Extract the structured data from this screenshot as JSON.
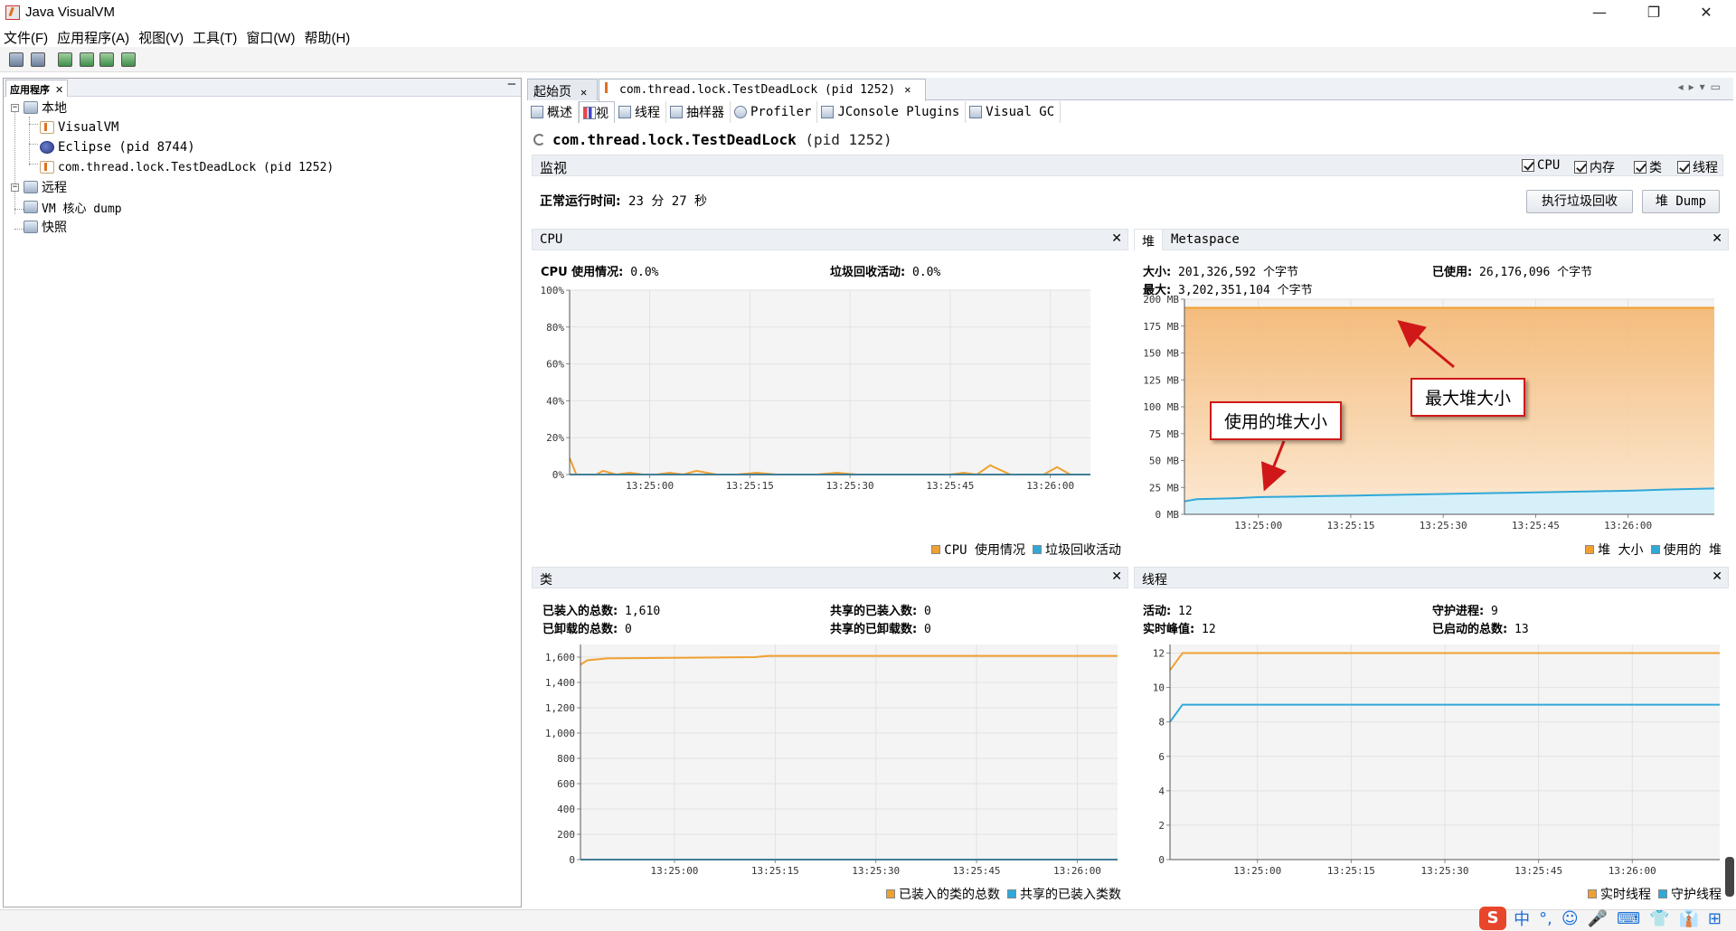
{
  "window": {
    "title": "Java VisualVM",
    "controls": {
      "minimize": "—",
      "restore": "❐",
      "close": "✕"
    }
  },
  "menubar": [
    "文件(F)",
    "应用程序(A)",
    "视图(V)",
    "工具(T)",
    "窗口(W)",
    "帮助(H)"
  ],
  "left_pane": {
    "tab_label": "应用程序",
    "tree": {
      "local": "本地",
      "visualvm": "VisualVM",
      "eclipse": "Eclipse (pid 8744)",
      "deadlock": "com.thread.lock.TestDeadLock (pid 1252)",
      "remote": "远程",
      "core_dump": "VM 核心 dump",
      "snapshots": "快照"
    }
  },
  "doc_tabs": {
    "start_page": "起始页",
    "process": "com.thread.lock.TestDeadLock (pid 1252)"
  },
  "sub_tabs": [
    "概述",
    "监视",
    "线程",
    "抽样器",
    "Profiler",
    "JConsole Plugins",
    "Visual GC"
  ],
  "heading": {
    "name": "com.thread.lock.TestDeadLock",
    "pid": "(pid 1252)"
  },
  "monitor_bar": {
    "label": "监视",
    "checkboxes": [
      "CPU",
      "内存",
      "类",
      "线程"
    ]
  },
  "uptime": {
    "label": "正常运行时间:",
    "value": "23 分 27 秒"
  },
  "buttons": {
    "gc": "执行垃圾回收",
    "heap_dump": "堆 Dump"
  },
  "cpu_panel": {
    "title": "CPU",
    "usage_label": "CPU 使用情况:",
    "usage_value": "0.0%",
    "gc_label": "垃圾回收活动:",
    "gc_value": "0.0%",
    "legend": [
      "CPU 使用情况",
      "垃圾回收活动"
    ]
  },
  "heap_panel": {
    "tab_heap": "堆",
    "tab_meta": "Metaspace",
    "size_label": "大小:",
    "size_value": "201,326,592 个字节",
    "max_label": "最大:",
    "max_value": "3,202,351,104 个字节",
    "used_label": "已使用:",
    "used_value": "26,176,096 个字节",
    "legend": [
      "堆 大小",
      "使用的 堆"
    ]
  },
  "classes_panel": {
    "title": "类",
    "loaded_label": "已装入的总数:",
    "loaded_value": "1,610",
    "unloaded_label": "已卸载的总数:",
    "unloaded_value": "0",
    "shared_loaded_label": "共享的已装入数:",
    "shared_loaded_value": "0",
    "shared_unloaded_label": "共享的已卸载数:",
    "shared_unloaded_value": "0",
    "legend": [
      "已装入的类的总数",
      "共享的已装入类数"
    ]
  },
  "threads_panel": {
    "title": "线程",
    "live_label": "活动:",
    "live_value": "12",
    "peak_label": "实时峰值:",
    "peak_value": "12",
    "daemon_label": "守护进程:",
    "daemon_value": "9",
    "started_label": "已启动的总数:",
    "started_value": "13",
    "legend": [
      "实时线程",
      "守护线程"
    ]
  },
  "callouts": {
    "max_heap": "最大堆大小",
    "used_heap": "使用的堆大小"
  },
  "ime": {
    "logo": "S",
    "items": [
      "中",
      "°,",
      "☺",
      "🎤",
      "⌨",
      "👕",
      "👔",
      "⊞"
    ]
  },
  "colors": {
    "orange": "#f0a030",
    "blue": "#30a8d8",
    "heap_fill": "#f6c58c",
    "used_fill": "#d6f0fa",
    "callout_border": "#d01818"
  },
  "chart_data": [
    {
      "type": "line",
      "name": "cpu",
      "ylim": [
        0,
        100
      ],
      "yticks": [
        "100%",
        "80%",
        "60%",
        "40%",
        "20%",
        "0%"
      ],
      "xticks": [
        "13:25:00",
        "13:25:15",
        "13:25:30",
        "13:25:45",
        "13:26:00"
      ],
      "series": [
        {
          "name": "CPU 使用情况",
          "color": "#f0a030",
          "x": [
            "13:24:48",
            "13:24:49",
            "13:24:52",
            "13:24:53",
            "13:24:55",
            "13:24:57",
            "13:24:59",
            "13:25:01",
            "13:25:03",
            "13:25:05",
            "13:25:07",
            "13:25:10",
            "13:25:13",
            "13:25:16",
            "13:25:19",
            "13:25:22",
            "13:25:25",
            "13:25:28",
            "13:25:31",
            "13:25:34",
            "13:25:37",
            "13:25:40",
            "13:25:43",
            "13:25:45",
            "13:25:47",
            "13:25:49",
            "13:25:51",
            "13:25:54",
            "13:25:57",
            "13:25:59",
            "13:26:01",
            "13:26:03",
            "13:26:06"
          ],
          "values": [
            9,
            0,
            0,
            2,
            0,
            1,
            0,
            0,
            1,
            0,
            2,
            0,
            0,
            1,
            0,
            0,
            0,
            1,
            0,
            0,
            0,
            0,
            0,
            0,
            1,
            0,
            5,
            0,
            0,
            0,
            4,
            0,
            0
          ]
        },
        {
          "name": "垃圾回收活动",
          "color": "#30a8d8",
          "x": [
            "13:24:48",
            "13:26:06"
          ],
          "values": [
            0,
            0
          ]
        }
      ]
    },
    {
      "type": "area",
      "name": "heap",
      "ylim": [
        0,
        200
      ],
      "yticks": [
        "200 MB",
        "175 MB",
        "150 MB",
        "125 MB",
        "100 MB",
        "75 MB",
        "50 MB",
        "25 MB",
        "0 MB"
      ],
      "xticks": [
        "13:25:00",
        "13:25:15",
        "13:25:30",
        "13:25:45",
        "13:26:00"
      ],
      "series": [
        {
          "name": "堆 大小",
          "color": "#f0a030",
          "x": [
            "13:24:48",
            "13:26:14"
          ],
          "values": [
            192,
            192
          ]
        },
        {
          "name": "使用的 堆",
          "color": "#30a8d8",
          "x": [
            "13:24:48",
            "13:24:50",
            "13:24:56",
            "13:25:00",
            "13:25:06",
            "13:25:11",
            "13:25:16",
            "13:25:21",
            "13:25:26",
            "13:25:31",
            "13:25:36",
            "13:25:41",
            "13:25:46",
            "13:25:51",
            "13:25:56",
            "13:26:01",
            "13:26:06",
            "13:26:14"
          ],
          "values": [
            12,
            14,
            15,
            16,
            16.5,
            17,
            17.5,
            18,
            18.5,
            19,
            19.5,
            20,
            20.5,
            21,
            21.5,
            22,
            23,
            24
          ]
        }
      ]
    },
    {
      "type": "line",
      "name": "classes",
      "ylim": [
        0,
        1700
      ],
      "yticks": [
        "1,600",
        "1,400",
        "1,200",
        "1,000",
        "800",
        "600",
        "400",
        "200",
        "0"
      ],
      "xticks": [
        "13:25:00",
        "13:25:15",
        "13:25:30",
        "13:25:45",
        "13:26:00"
      ],
      "series": [
        {
          "name": "已装入的类的总数",
          "color": "#f0a030",
          "x": [
            "13:24:46",
            "13:24:47",
            "13:24:50",
            "13:25:00",
            "13:25:12",
            "13:25:13",
            "13:25:14",
            "13:26:06"
          ],
          "values": [
            1540,
            1575,
            1590,
            1595,
            1600,
            1605,
            1610,
            1610
          ]
        },
        {
          "name": "共享的已装入类数",
          "color": "#30a8d8",
          "x": [
            "13:24:46",
            "13:26:06"
          ],
          "values": [
            0,
            0
          ]
        }
      ]
    },
    {
      "type": "line",
      "name": "threads",
      "ylim": [
        0,
        12.5
      ],
      "yticks": [
        "12",
        "10",
        "8",
        "6",
        "4",
        "2",
        "0"
      ],
      "xticks": [
        "13:25:00",
        "13:25:15",
        "13:25:30",
        "13:25:45",
        "13:26:00"
      ],
      "series": [
        {
          "name": "实时线程",
          "color": "#f0a030",
          "x": [
            "13:24:46",
            "13:24:48",
            "13:26:14"
          ],
          "values": [
            11,
            12,
            12
          ]
        },
        {
          "name": "守护线程",
          "color": "#30a8d8",
          "x": [
            "13:24:46",
            "13:24:48",
            "13:26:14"
          ],
          "values": [
            8,
            9,
            9
          ]
        }
      ]
    }
  ]
}
